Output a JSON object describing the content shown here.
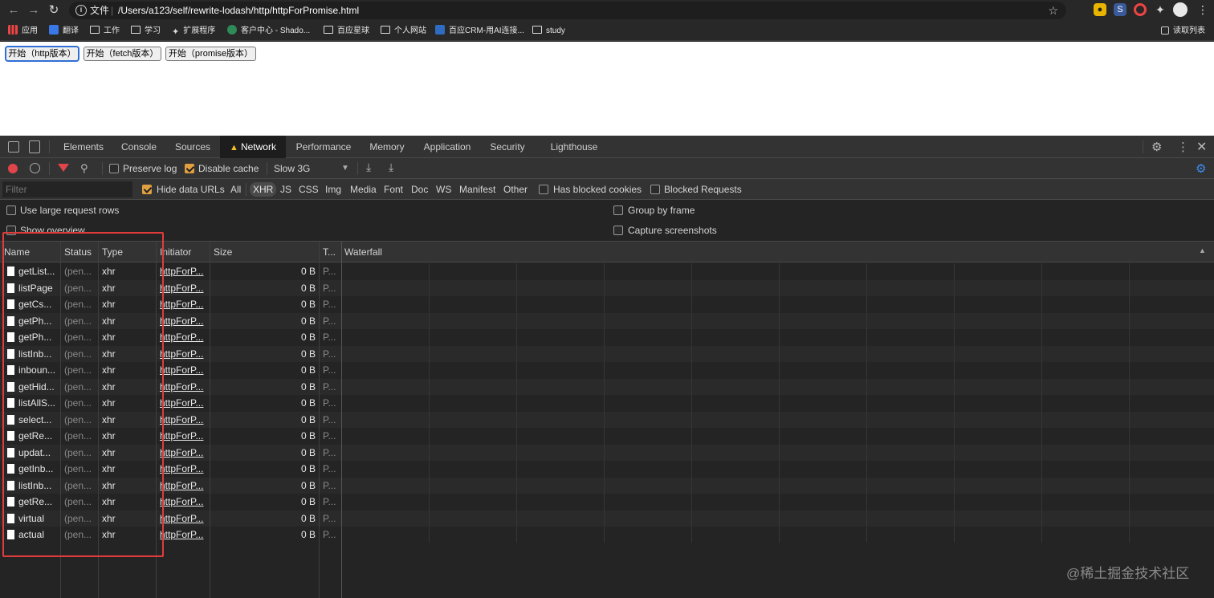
{
  "browser": {
    "scheme_label": "文件",
    "url": "/Users/a123/self/rewrite-lodash/http/httpForPromise.html",
    "bookmarks": [
      "应用",
      "翻译",
      "工作",
      "学习",
      "扩展程序",
      "客户中心 - Shado...",
      "百应星球",
      "个人网站",
      "百应CRM-用AI连接...",
      "study"
    ],
    "reading_list": "读取列表"
  },
  "page": {
    "buttons": [
      "开始（http版本）",
      "开始（fetch版本）",
      "开始（promise版本）"
    ]
  },
  "devtools": {
    "tabs": [
      "Elements",
      "Console",
      "Sources",
      "Network",
      "Performance",
      "Memory",
      "Application",
      "Security",
      "Lighthouse"
    ],
    "active_tab": "Network",
    "toolbar": {
      "preserve_log": "Preserve log",
      "disable_cache": "Disable cache",
      "throttle": "Slow 3G"
    },
    "filter": {
      "placeholder": "Filter",
      "hide_data_urls": "Hide data URLs",
      "types": [
        "All",
        "XHR",
        "JS",
        "CSS",
        "Img",
        "Media",
        "Font",
        "Doc",
        "WS",
        "Manifest",
        "Other"
      ],
      "active_type": "XHR",
      "has_blocked_cookies": "Has blocked cookies",
      "blocked_requests": "Blocked Requests"
    },
    "settings": {
      "large_rows": "Use large request rows",
      "show_overview": "Show overview",
      "group_by_frame": "Group by frame",
      "capture_screenshots": "Capture screenshots"
    },
    "columns": [
      "Name",
      "Status",
      "Type",
      "Initiator",
      "Size",
      "T...",
      "Waterfall"
    ],
    "rows": [
      {
        "name": "getList...",
        "status": "(pen...",
        "type": "xhr",
        "initiator": "httpForP...",
        "size": "0 B",
        "time": "P..."
      },
      {
        "name": "listPage",
        "status": "(pen...",
        "type": "xhr",
        "initiator": "httpForP...",
        "size": "0 B",
        "time": "P..."
      },
      {
        "name": "getCs...",
        "status": "(pen...",
        "type": "xhr",
        "initiator": "httpForP...",
        "size": "0 B",
        "time": "P..."
      },
      {
        "name": "getPh...",
        "status": "(pen...",
        "type": "xhr",
        "initiator": "httpForP...",
        "size": "0 B",
        "time": "P..."
      },
      {
        "name": "getPh...",
        "status": "(pen...",
        "type": "xhr",
        "initiator": "httpForP...",
        "size": "0 B",
        "time": "P..."
      },
      {
        "name": "listInb...",
        "status": "(pen...",
        "type": "xhr",
        "initiator": "httpForP...",
        "size": "0 B",
        "time": "P..."
      },
      {
        "name": "inboun...",
        "status": "(pen...",
        "type": "xhr",
        "initiator": "httpForP...",
        "size": "0 B",
        "time": "P..."
      },
      {
        "name": "getHid...",
        "status": "(pen...",
        "type": "xhr",
        "initiator": "httpForP...",
        "size": "0 B",
        "time": "P..."
      },
      {
        "name": "listAllS...",
        "status": "(pen...",
        "type": "xhr",
        "initiator": "httpForP...",
        "size": "0 B",
        "time": "P..."
      },
      {
        "name": "select...",
        "status": "(pen...",
        "type": "xhr",
        "initiator": "httpForP...",
        "size": "0 B",
        "time": "P..."
      },
      {
        "name": "getRe...",
        "status": "(pen...",
        "type": "xhr",
        "initiator": "httpForP...",
        "size": "0 B",
        "time": "P..."
      },
      {
        "name": "updat...",
        "status": "(pen...",
        "type": "xhr",
        "initiator": "httpForP...",
        "size": "0 B",
        "time": "P..."
      },
      {
        "name": "getInb...",
        "status": "(pen...",
        "type": "xhr",
        "initiator": "httpForP...",
        "size": "0 B",
        "time": "P..."
      },
      {
        "name": "listInb...",
        "status": "(pen...",
        "type": "xhr",
        "initiator": "httpForP...",
        "size": "0 B",
        "time": "P..."
      },
      {
        "name": "getRe...",
        "status": "(pen...",
        "type": "xhr",
        "initiator": "httpForP...",
        "size": "0 B",
        "time": "P..."
      },
      {
        "name": "virtual",
        "status": "(pen...",
        "type": "xhr",
        "initiator": "httpForP...",
        "size": "0 B",
        "time": "P..."
      },
      {
        "name": "actual",
        "status": "(pen...",
        "type": "xhr",
        "initiator": "httpForP...",
        "size": "0 B",
        "time": "P..."
      }
    ]
  },
  "watermark": "@稀土掘金技术社区",
  "colors": {
    "highlight_box": "#e23b3b",
    "record_button": "#e0454b",
    "checkbox_checked": "#e0a040",
    "filter_icon": "#e0454b",
    "gear_accent": "#3c8cf0"
  }
}
